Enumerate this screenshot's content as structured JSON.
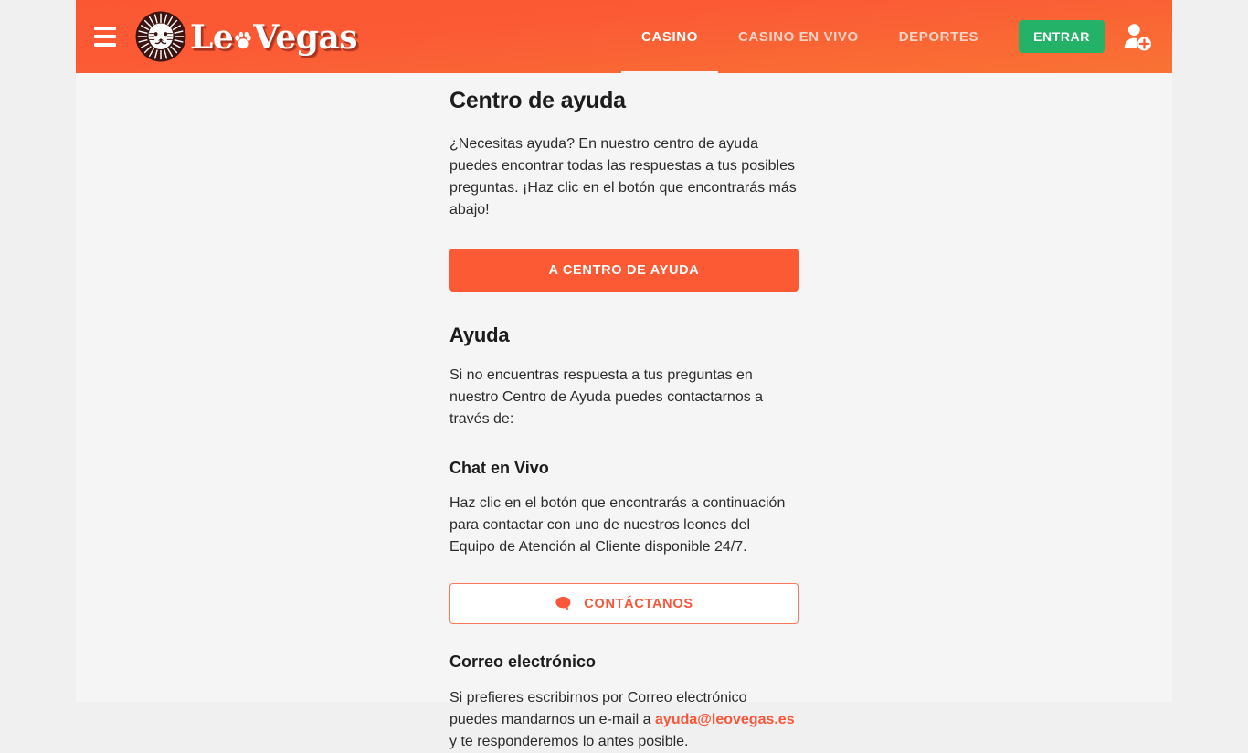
{
  "brand": {
    "name": "LeoVegas",
    "name_part1": "Le",
    "name_part2": "Vegas",
    "logo_icon": "lion-head-icon",
    "paw_icon": "paw-print-icon",
    "accent_color": "#fb5a35"
  },
  "header": {
    "menu_icon": "hamburger-menu-icon",
    "register_icon": "add-user-icon",
    "login_label": "ENTRAR",
    "login_color": "#23b267",
    "nav": [
      {
        "label": "CASINO",
        "active": true
      },
      {
        "label": "CASINO EN VIVO",
        "active": false
      },
      {
        "label": "DEPORTES",
        "active": false
      }
    ]
  },
  "main": {
    "help_center": {
      "title": "Centro de ayuda",
      "paragraph": "¿Necesitas ayuda? En nuestro centro de ayuda puedes encontrar todas las respuestas a tus posibles preguntas. ¡Haz clic en el botón que encontrarás más abajo!",
      "cta_label": "A CENTRO DE AYUDA"
    },
    "help": {
      "title": "Ayuda",
      "paragraph": "Si no encuentras respuesta a tus preguntas en nuestro Centro de Ayuda puedes contactarnos a través de:"
    },
    "live_chat": {
      "title": "Chat en Vivo",
      "paragraph": "Haz clic en el botón que encontrarás a continuación para contactar con uno de nuestros leones del Equipo de Atención al Cliente disponible 24/7.",
      "cta_label": "CONTÁCTANOS",
      "cta_icon": "chat-bubble-icon"
    },
    "email": {
      "title": "Correo electrónico",
      "paragraph_before": "Si prefieres escribirnos por Correo electrónico puedes mandarnos un e-mail a ",
      "link_text": "ayuda@leovegas.es",
      "paragraph_after": " y te responderemos lo antes posible."
    }
  }
}
